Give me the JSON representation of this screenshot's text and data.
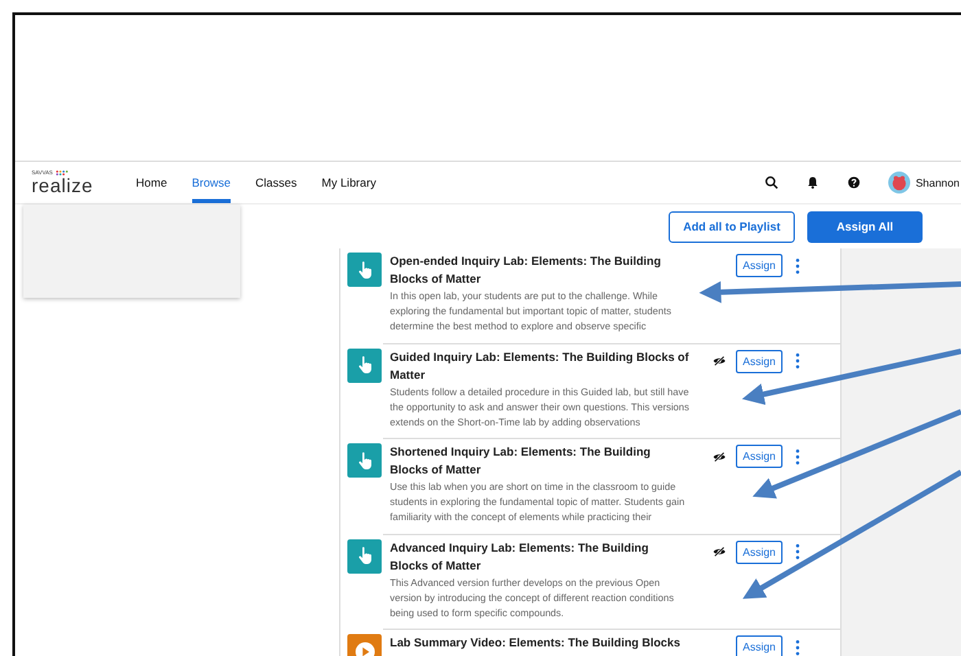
{
  "header": {
    "brand_small": "SAVVAS",
    "brand": "realize",
    "user": {
      "name": "Shannon"
    }
  },
  "nav_tabs": [
    {
      "label": "Home",
      "selected": false
    },
    {
      "label": "Browse",
      "selected": true
    },
    {
      "label": "Classes",
      "selected": false
    },
    {
      "label": "My Library",
      "selected": false
    }
  ],
  "actions": {
    "playlist_button": "Add all to Playlist",
    "assign_all_button": "Assign All"
  },
  "items": [
    {
      "kind": "interactive",
      "title": "Open-ended Inquiry Lab: Elements: The Building Blocks of Matter",
      "description": "In this open lab, your students are put to the challenge. While exploring the fundamental but important topic of matter, students determine the best method to explore and observe specific",
      "hidden": false,
      "assign": "Assign"
    },
    {
      "kind": "interactive",
      "title": "Guided Inquiry Lab: Elements: The Building Blocks of Matter",
      "description": "Students follow a detailed procedure in this Guided lab, but still have the opportunity to ask and answer their own questions. This versions extends on the Short-on-Time lab by adding observations",
      "hidden": true,
      "assign": "Assign"
    },
    {
      "kind": "interactive",
      "title": "Shortened Inquiry Lab: Elements: The Building Blocks of Matter",
      "description": "Use this lab when you are short on time in the classroom to guide students in exploring the fundamental topic of matter. Students gain familiarity with the concept of elements while practicing their",
      "hidden": true,
      "assign": "Assign"
    },
    {
      "kind": "interactive",
      "title": "Advanced Inquiry Lab: Elements: The Building Blocks of Matter",
      "description": "This Advanced version further develops on the previous Open version by introducing the concept of different reaction conditions being used to form specific compounds.",
      "hidden": true,
      "assign": "Assign"
    },
    {
      "kind": "video",
      "title": "Lab Summary Video: Elements: The Building Blocks",
      "hidden": false,
      "assign": "Assign"
    }
  ]
}
